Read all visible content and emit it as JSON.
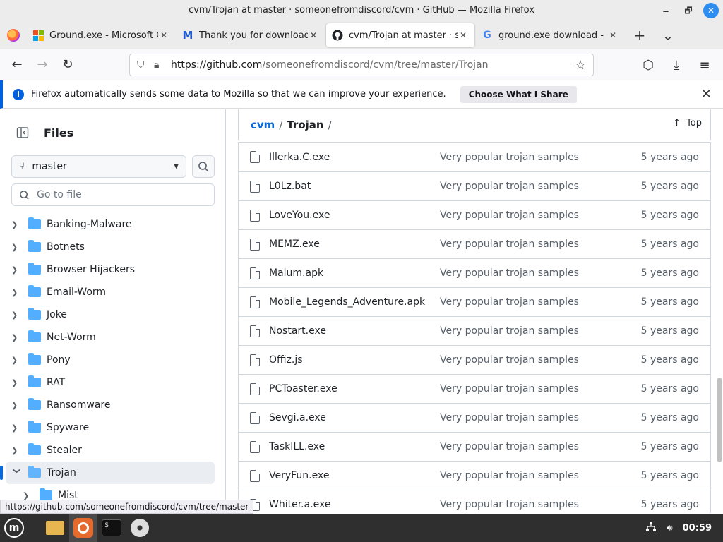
{
  "window": {
    "title": "cvm/Trojan at master · someonefromdiscord/cvm · GitHub — Mozilla Firefox",
    "minimize": "🗕",
    "maximize": "🗗",
    "close": "✕"
  },
  "tabs": [
    {
      "label": "Ground.exe - Microsoft Com",
      "icon": "microsoft-icon",
      "active": false
    },
    {
      "label": "Thank you for downloading",
      "icon": "malwarebytes-icon",
      "active": false
    },
    {
      "label": "cvm/Trojan at master · some",
      "icon": "github-icon",
      "active": true
    },
    {
      "label": "ground.exe download - Goo",
      "icon": "google-icon",
      "active": false
    }
  ],
  "tab_close": "✕",
  "tab_new": "+",
  "tab_list": "⌄",
  "nav": {
    "back": "←",
    "forward": "→",
    "reload": "↻",
    "url_host": "https://github.com",
    "url_path": "/someonefromdiscord/cvm/tree/master/Trojan",
    "bookmark": "☆",
    "pocket": "⬡",
    "downloads": "⤓",
    "menu": "≡"
  },
  "infobar": {
    "text": "Firefox automatically sends some data to Mozilla so that we can improve your experience.",
    "button": "Choose What I Share",
    "close": "✕"
  },
  "sidebar": {
    "title": "Files",
    "branch": "master",
    "go_to_file": "Go to file",
    "tree": [
      {
        "label": "Banking-Malware",
        "expanded": false
      },
      {
        "label": "Botnets",
        "expanded": false
      },
      {
        "label": "Browser Hijackers",
        "expanded": false
      },
      {
        "label": "Email-Worm",
        "expanded": false
      },
      {
        "label": "Joke",
        "expanded": false
      },
      {
        "label": "Net-Worm",
        "expanded": false
      },
      {
        "label": "Pony",
        "expanded": false
      },
      {
        "label": "RAT",
        "expanded": false
      },
      {
        "label": "Ransomware",
        "expanded": false
      },
      {
        "label": "Spyware",
        "expanded": false
      },
      {
        "label": "Stealer",
        "expanded": false
      },
      {
        "label": "Trojan",
        "expanded": true
      },
      {
        "label": "Mist",
        "expanded": false
      }
    ]
  },
  "breadcrumb": {
    "repo": "cvm",
    "sep": "/",
    "current": "Trojan",
    "trailing": "/",
    "top": "Top"
  },
  "files": [
    {
      "name": "Illerka.C.exe",
      "message": "Very popular trojan samples",
      "date": "5 years ago"
    },
    {
      "name": "L0Lz.bat",
      "message": "Very popular trojan samples",
      "date": "5 years ago"
    },
    {
      "name": "LoveYou.exe",
      "message": "Very popular trojan samples",
      "date": "5 years ago"
    },
    {
      "name": "MEMZ.exe",
      "message": "Very popular trojan samples",
      "date": "5 years ago"
    },
    {
      "name": "Malum.apk",
      "message": "Very popular trojan samples",
      "date": "5 years ago"
    },
    {
      "name": "Mobile_Legends_Adventure.apk",
      "message": "Very popular trojan samples",
      "date": "5 years ago"
    },
    {
      "name": "Nostart.exe",
      "message": "Very popular trojan samples",
      "date": "5 years ago"
    },
    {
      "name": "Offiz.js",
      "message": "Very popular trojan samples",
      "date": "5 years ago"
    },
    {
      "name": "PCToaster.exe",
      "message": "Very popular trojan samples",
      "date": "5 years ago"
    },
    {
      "name": "Sevgi.a.exe",
      "message": "Very popular trojan samples",
      "date": "5 years ago"
    },
    {
      "name": "TaskILL.exe",
      "message": "Very popular trojan samples",
      "date": "5 years ago"
    },
    {
      "name": "VeryFun.exe",
      "message": "Very popular trojan samples",
      "date": "5 years ago"
    },
    {
      "name": "Whiter.a.exe",
      "message": "Very popular trojan samples",
      "date": "5 years ago"
    }
  ],
  "status_url": "https://github.com/someonefromdiscord/cvm/tree/master",
  "taskbar": {
    "terminal_text": "$_",
    "clock": "00:59"
  },
  "colors": {
    "link": "#0969da",
    "folder": "#54aeff",
    "accent": "#0061e0"
  }
}
